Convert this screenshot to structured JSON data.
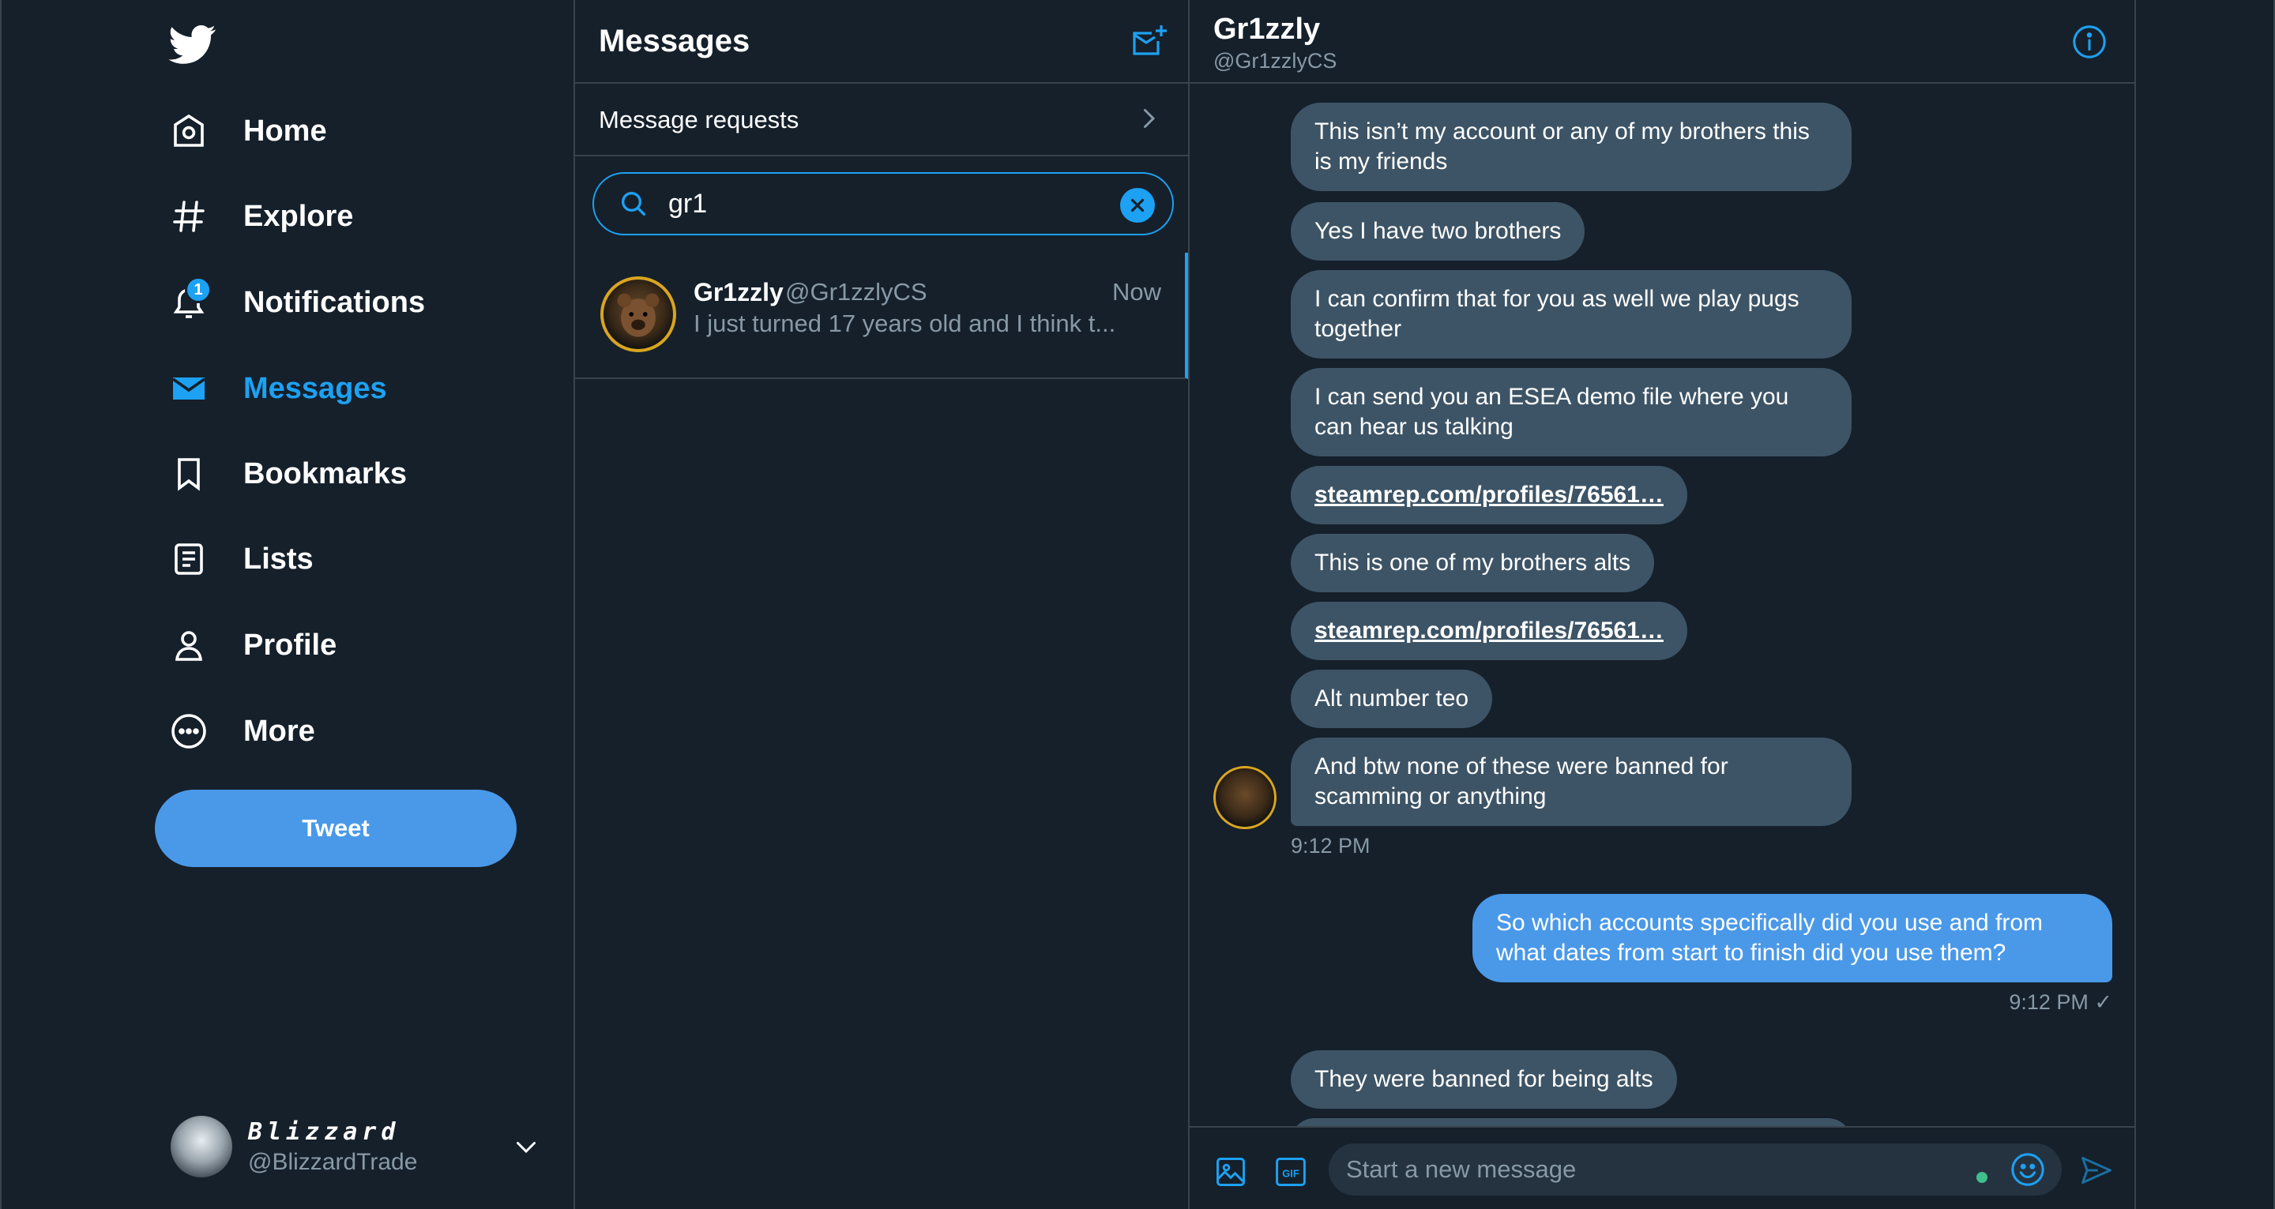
{
  "nav": {
    "items": [
      {
        "label": "Home",
        "icon": "home-icon"
      },
      {
        "label": "Explore",
        "icon": "hashtag-icon"
      },
      {
        "label": "Notifications",
        "icon": "bell-icon",
        "badge": "1"
      },
      {
        "label": "Messages",
        "icon": "envelope-icon",
        "active": true
      },
      {
        "label": "Bookmarks",
        "icon": "bookmark-icon"
      },
      {
        "label": "Lists",
        "icon": "list-icon"
      },
      {
        "label": "Profile",
        "icon": "person-icon"
      },
      {
        "label": "More",
        "icon": "more-circle-icon"
      }
    ],
    "tweet_label": "Tweet",
    "account": {
      "name": "Blizzard",
      "handle": "@BlizzardTrade"
    }
  },
  "messages": {
    "title": "Messages",
    "requests_label": "Message requests",
    "search_value": "gr1",
    "conversation": {
      "name": "Gr1zzly",
      "handle": "@Gr1zzlyCS",
      "time": "Now",
      "preview": "I just turned 17 years old and I think t..."
    }
  },
  "chat": {
    "name": "Gr1zzly",
    "handle": "@Gr1zzlyCS",
    "received": [
      "This isn’t my account or any of my brothers this is my friends",
      "Yes I have two brothers",
      "I can confirm that for you as well we play pugs together",
      "I can send you an ESEA demo file where you can hear us talking",
      "steamrep.com/profiles/76561…",
      "This is one of my brothers alts",
      "steamrep.com/profiles/76561…",
      "Alt number teo",
      "And btw none of these were banned for scamming or anything"
    ],
    "received_time": "9:12 PM",
    "sent": "So which accounts specifically did you use and from what dates from start to finish did you use them?",
    "sent_time": "9:12 PM ✓",
    "received_2": "They were banned for being alts",
    "composer_placeholder": "Start a new message"
  },
  "colors": {
    "background": "#15202b",
    "accent": "#1da1f2",
    "bubble_received": "#3d5466",
    "bubble_sent": "#4a99e9",
    "divider": "#38444d",
    "muted_text": "#8899a6"
  }
}
